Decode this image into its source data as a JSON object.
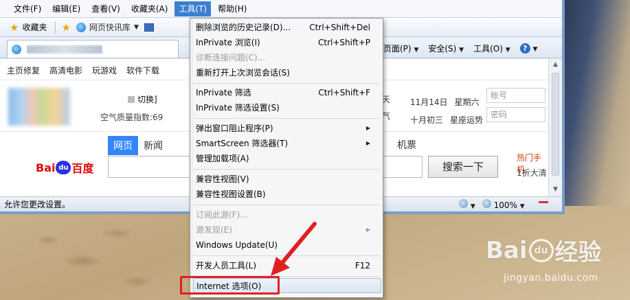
{
  "menubar": {
    "items": [
      "文件(F)",
      "编辑(E)",
      "查看(V)",
      "收藏夹(A)",
      "工具(T)",
      "帮助(H)"
    ],
    "active_index": 4
  },
  "favbar": {
    "favorites_label": "收藏夹",
    "quicklinks_label": "网页快讯库"
  },
  "cmdbar": {
    "page_label": "页面(P)",
    "safety_label": "安全(S)",
    "tools_label": "工具(O)"
  },
  "page": {
    "nav_links": [
      "主页修复",
      "高清电影",
      "玩游戏",
      "软件下载"
    ],
    "switch_label": "切换]",
    "aqi_label": "空气质量指数:69",
    "weather": {
      "tian": "天",
      "qi": "气"
    },
    "date_line1": [
      "11月14日",
      "星期六"
    ],
    "date_line2": [
      "十月初三",
      "星座运势"
    ],
    "login": {
      "account_placeholder": "帐号",
      "password_placeholder": "密码"
    },
    "search_tabs": [
      "网页",
      "新闻"
    ],
    "search_tab_active": 0,
    "jipiao": "机票",
    "baidu_logo": {
      "left": "Bai",
      "paw": "du",
      "right": "百度"
    },
    "search_button": "搜索一下",
    "hot_label": "热门手机",
    "hot_sub": "1折大清"
  },
  "statusbar": {
    "text": "允许您更改设置。",
    "zoom": "100%"
  },
  "tools_menu": {
    "items": [
      {
        "label": "删除浏览的历史记录(D)...",
        "shortcut": "Ctrl+Shift+Del",
        "disabled": false
      },
      {
        "label": "InPrivate 浏览(I)",
        "shortcut": "Ctrl+Shift+P",
        "disabled": false
      },
      {
        "label": "诊断连接问题(C)...",
        "shortcut": "",
        "disabled": true
      },
      {
        "label": "重新打开上次浏览会话(S)",
        "shortcut": "",
        "disabled": false
      },
      {
        "label": "InPrivate 筛选",
        "shortcut": "Ctrl+Shift+F",
        "disabled": false
      },
      {
        "label": "InPrivate 筛选设置(S)",
        "shortcut": "",
        "disabled": false
      },
      {
        "label": "弹出窗口阻止程序(P)",
        "shortcut": "",
        "submenu": true,
        "disabled": false
      },
      {
        "label": "SmartScreen 筛选器(T)",
        "shortcut": "",
        "submenu": true,
        "disabled": false
      },
      {
        "label": "管理加载项(A)",
        "shortcut": "",
        "disabled": false
      },
      {
        "label": "兼容性视图(V)",
        "shortcut": "",
        "disabled": false
      },
      {
        "label": "兼容性视图设置(B)",
        "shortcut": "",
        "disabled": false
      },
      {
        "label": "订阅此源(F)...",
        "shortcut": "",
        "disabled": true
      },
      {
        "label": "源发现(E)",
        "shortcut": "",
        "submenu": true,
        "disabled": true
      },
      {
        "label": "Windows Update(U)",
        "shortcut": "",
        "disabled": false
      },
      {
        "label": "开发人员工具(L)",
        "shortcut": "F12",
        "disabled": false
      },
      {
        "label": "Internet 选项(O)",
        "shortcut": "",
        "disabled": false,
        "highlighted": true
      }
    ]
  },
  "watermark": {
    "brand_left": "Bai",
    "paw": "du",
    "brand_right": "经验",
    "url": "jingyan.baidu.com"
  },
  "colors": {
    "menu_highlight": "#3c7fd2",
    "annotation_red": "#e02020",
    "baidu_blue": "#3385ff"
  }
}
